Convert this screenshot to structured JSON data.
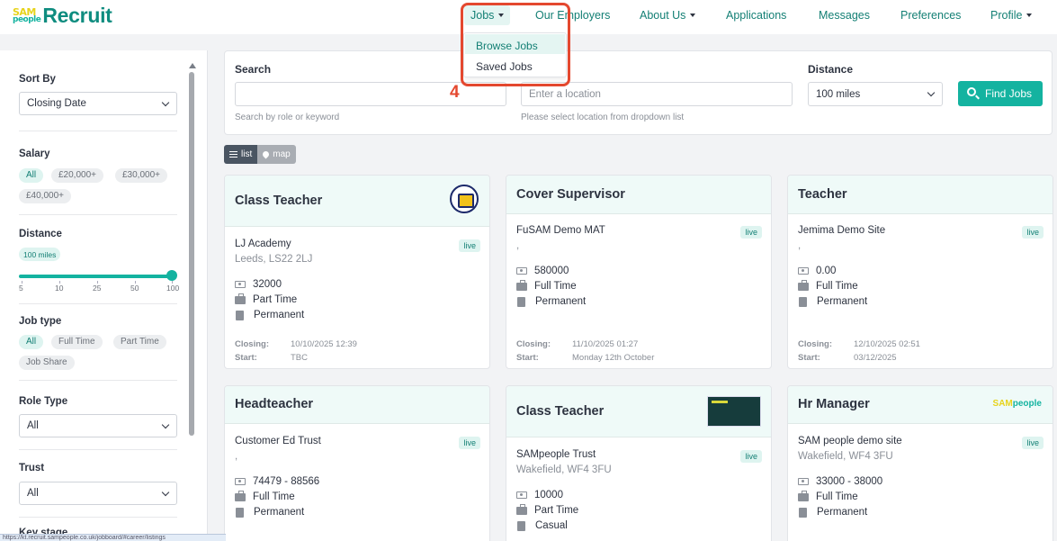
{
  "brand": {
    "mark_top": "SAM",
    "mark_bottom": "people",
    "name": "Recruit"
  },
  "nav": {
    "jobs": "Jobs",
    "employers": "Our Employers",
    "about": "About Us",
    "applications": "Applications",
    "messages": "Messages",
    "preferences": "Preferences",
    "profile": "Profile"
  },
  "jobs_menu": {
    "items": [
      "Browse Jobs",
      "Saved Jobs"
    ]
  },
  "annotation": {
    "step": "4",
    "color": "#e4482f"
  },
  "sidebar": {
    "sort_label": "Sort By",
    "sort_value": "Closing Date",
    "salary_label": "Salary",
    "salary_options": [
      "All",
      "£20,000+",
      "£30,000+",
      "£40,000+"
    ],
    "distance_label": "Distance",
    "distance_value": "100 miles",
    "distance_ticks": [
      "5",
      "10",
      "25",
      "50",
      "100"
    ],
    "jobtype_label": "Job type",
    "jobtype_options": [
      "All",
      "Full Time",
      "Part Time",
      "Job Share"
    ],
    "roletype_label": "Role Type",
    "roletype_value": "All",
    "trust_label": "Trust",
    "trust_value": "All",
    "keystage_label": "Key stage"
  },
  "status_url": "https://kt.recruit.sampeople.co.uk/jobboard/#career/listings",
  "search": {
    "search_label": "Search",
    "search_placeholder": "",
    "search_help": "Search by role or keyword",
    "location_placeholder": "Enter a location",
    "location_help": "Please select location from dropdown list",
    "distance_label": "Distance",
    "distance_value": "100 miles",
    "button": "Find Jobs"
  },
  "view": {
    "list": "list",
    "map": "map"
  },
  "jobs": [
    {
      "title": "Class Teacher",
      "org": "LJ Academy",
      "location": "Leeds, LS22 2LJ",
      "status": "live",
      "salary": "32000",
      "hours": "Part Time",
      "contract": "Permanent",
      "closing_label": "Closing:",
      "closing": "10/10/2025 12:39",
      "start_label": "Start:",
      "start": "TBC",
      "logo": "school-crest"
    },
    {
      "title": "Cover Supervisor",
      "org": "FuSAM Demo MAT",
      "location": ",",
      "status": "live",
      "salary": "580000",
      "hours": "Full Time",
      "contract": "Permanent",
      "closing_label": "Closing:",
      "closing": "11/10/2025 01:27",
      "start_label": "Start:",
      "start": "Monday 12th October",
      "logo": ""
    },
    {
      "title": "Teacher",
      "org": "Jemima Demo Site",
      "location": ",",
      "status": "live",
      "salary": "0.00",
      "hours": "Full Time",
      "contract": "Permanent",
      "closing_label": "Closing:",
      "closing": "12/10/2025 02:51",
      "start_label": "Start:",
      "start": "03/12/2025",
      "logo": ""
    },
    {
      "title": "Headteacher",
      "org": "Customer Ed Trust",
      "location": ",",
      "status": "live",
      "salary": "74479 - 88566",
      "hours": "Full Time",
      "contract": "Permanent",
      "logo": ""
    },
    {
      "title": "Class Teacher",
      "org": "SAMpeople Trust",
      "location": "Wakefield, WF4 3FU",
      "status": "live",
      "salary": "10000",
      "hours": "Part Time",
      "contract": "Casual",
      "logo": "thumbnail"
    },
    {
      "title": "Hr Manager",
      "org": "SAM people demo site",
      "location": "Wakefield, WF4 3FU",
      "status": "live",
      "salary": "33000 - 38000",
      "hours": "Full Time",
      "contract": "Permanent",
      "logo": "sampeople"
    }
  ],
  "colors": {
    "brand": "#14b3a0",
    "brand_dark": "#137f74",
    "highlight": "#e4482f"
  }
}
